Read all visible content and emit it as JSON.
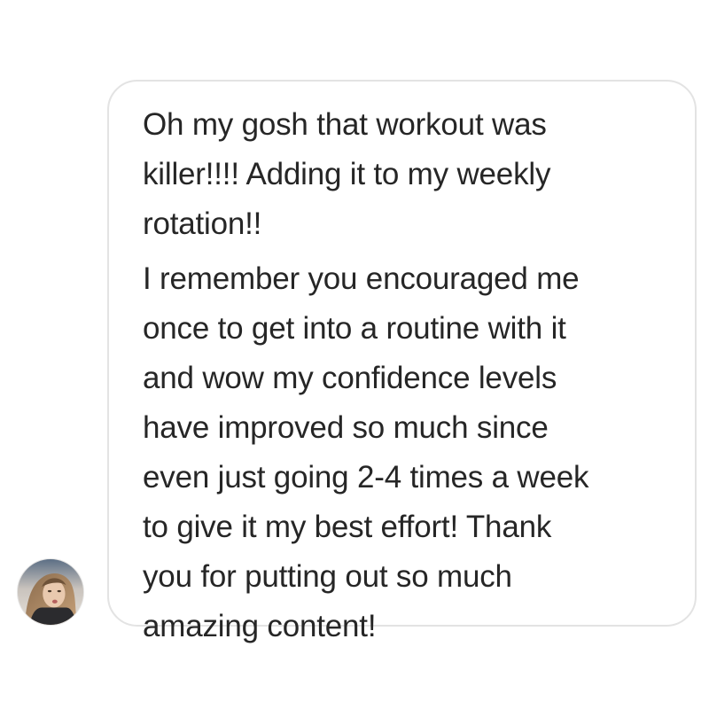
{
  "message": {
    "paragraphs": [
      {
        "lines": [
          "Oh my gosh that workout was",
          "killer!!!! Adding it to my weekly",
          "rotation!!"
        ]
      },
      {
        "lines": [
          "I remember you encouraged me",
          "once to get into a routine with it",
          "and wow my confidence levels",
          "have improved so much since",
          "even just going 2-4 times a week",
          "to give it my best effort! Thank",
          "you for putting out so much",
          "amazing content!"
        ]
      }
    ]
  },
  "sender": {
    "avatar_icon": "profile-photo"
  },
  "colors": {
    "text": "#262626",
    "bubble_border": "#e3e3e3",
    "background": "#ffffff"
  }
}
